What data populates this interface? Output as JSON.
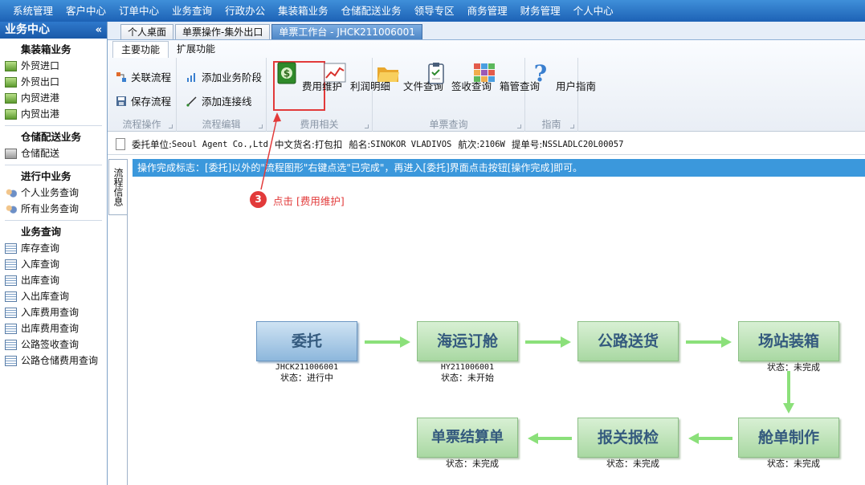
{
  "top_menu": [
    "系统管理",
    "客户中心",
    "订单中心",
    "业务查询",
    "行政办公",
    "集装箱业务",
    "仓储配送业务",
    "领导专区",
    "商务管理",
    "财务管理",
    "个人中心"
  ],
  "sidebar": {
    "title": "业务中心",
    "collapse": "«",
    "sections": [
      {
        "title": "集装箱业务",
        "items": [
          "外贸进口",
          "外贸出口",
          "内贸进港",
          "内贸出港"
        ]
      },
      {
        "title": "仓储配送业务",
        "items": [
          "仓储配送"
        ]
      },
      {
        "title": "进行中业务",
        "items": [
          "个人业务查询",
          "所有业务查询"
        ]
      },
      {
        "title": "业务查询",
        "items": [
          "库存查询",
          "入库查询",
          "出库查询",
          "入出库查询",
          "入库费用查询",
          "出库费用查询",
          "公路签收查询",
          "公路仓储费用查询"
        ]
      }
    ]
  },
  "tabs": [
    "个人桌面",
    "单票操作-集外出口",
    "单票工作台 - JHCK211006001"
  ],
  "ribbon": {
    "tabs": [
      "主要功能",
      "扩展功能"
    ],
    "groups": {
      "flow_op": {
        "label": "流程操作",
        "buttons": [
          "关联流程",
          "保存流程"
        ]
      },
      "flow_edit": {
        "label": "流程编辑",
        "buttons": [
          "添加业务阶段",
          "添加连接线"
        ]
      },
      "fee": {
        "label": "费用相关",
        "buttons": [
          "费用维护",
          "利润明细"
        ]
      },
      "query": {
        "label": "单票查询",
        "buttons": [
          "文件查询",
          "签收查询",
          "箱管查询"
        ]
      },
      "guide": {
        "label": "指南",
        "buttons": [
          "用户指南"
        ]
      }
    }
  },
  "info_bar": {
    "consignor_label": "委托单位:",
    "consignor": "Seoul Agent Co.,Ltd",
    "goods_label": "中文货名:",
    "goods": "打包扣",
    "vessel_label": "船名:",
    "vessel": "SINOKOR VLADIVOS",
    "voyage_label": "航次:",
    "voyage": "2106W",
    "bl_label": "提单号:",
    "bl": "NSSLADLC20L00057"
  },
  "side_tab": "流程信息",
  "notice": "操作完成标志：[委托]以外的\"流程图形\"右键点选\"已完成\"，再进入[委托]界面点击按钮[操作完成]即可。",
  "annotation": {
    "number": "3",
    "text": "点击 [费用维护]"
  },
  "flow": {
    "nodes": [
      {
        "label": "委托",
        "code": "JHCK211006001",
        "status": "状态：进行中"
      },
      {
        "label": "海运订舱",
        "code": "HY211006001",
        "status": "状态：未开始"
      },
      {
        "label": "公路送货",
        "code": "",
        "status": ""
      },
      {
        "label": "场站装箱",
        "code": "",
        "status": "状态：未完成"
      },
      {
        "label": "舱单制作",
        "code": "",
        "status": "状态：未完成"
      },
      {
        "label": "报关报检",
        "code": "",
        "status": "状态：未完成"
      },
      {
        "label": "单票结算单",
        "code": "",
        "status": "状态：未完成"
      }
    ]
  },
  "colors": {
    "menu_blue": "#1d62b5",
    "notice_blue": "#3b98dc",
    "annotation_red": "#e23a3a",
    "arrow_green": "#8be07a"
  }
}
